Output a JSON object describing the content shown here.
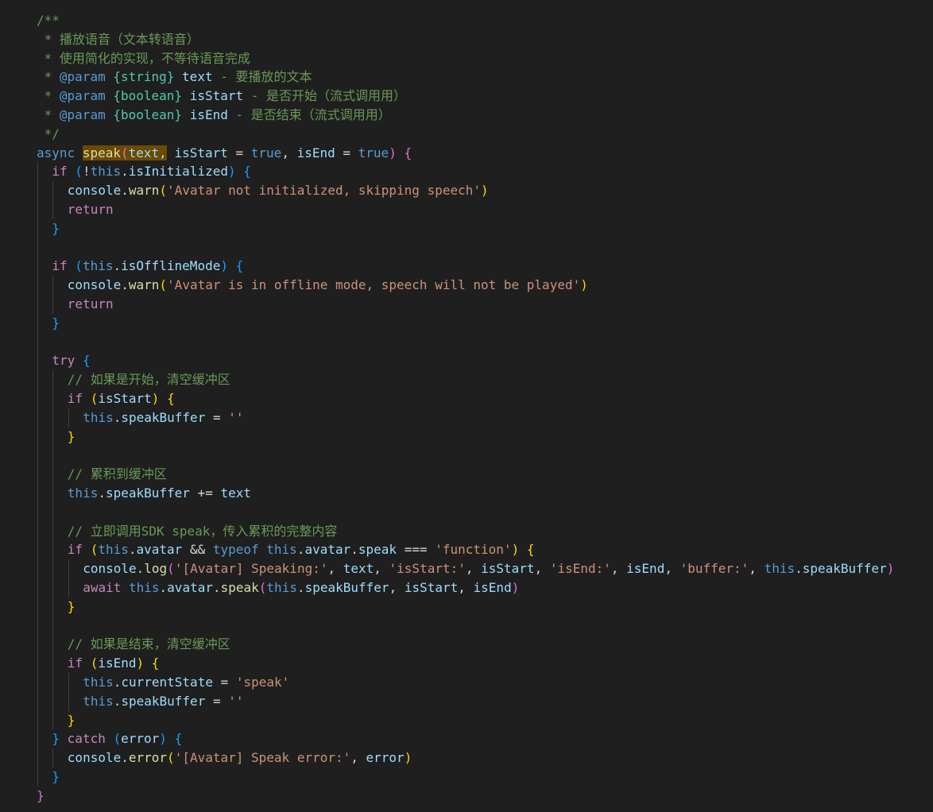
{
  "editor": {
    "language": "javascript",
    "colors": {
      "background": "#1f1f1f",
      "comment": "#6a9955",
      "keyword_control": "#c586c0",
      "keyword": "#569cd6",
      "function": "#dcdcaa",
      "variable": "#9cdcfe",
      "string": "#ce9178",
      "type": "#4ec9b0",
      "brace1": "#ffd700",
      "brace2": "#da70d6",
      "brace3": "#179fff",
      "search_highlight": "#6b4a00"
    },
    "lines": [
      {
        "indent": 0,
        "tokens": [
          [
            "/**",
            "c"
          ]
        ]
      },
      {
        "indent": 0,
        "tokens": [
          [
            " * 播放语音（文本转语音）",
            "c"
          ]
        ]
      },
      {
        "indent": 0,
        "tokens": [
          [
            " * 使用简化的实现，不等待语音完成",
            "c"
          ]
        ]
      },
      {
        "indent": 0,
        "tokens": [
          [
            " * ",
            "c"
          ],
          [
            "@param",
            "kw"
          ],
          [
            " ",
            "c"
          ],
          [
            "{string}",
            "ty"
          ],
          [
            " ",
            "c"
          ],
          [
            "text",
            "v"
          ],
          [
            " - 要播放的文本",
            "c"
          ]
        ]
      },
      {
        "indent": 0,
        "tokens": [
          [
            " * ",
            "c"
          ],
          [
            "@param",
            "kw"
          ],
          [
            " ",
            "c"
          ],
          [
            "{boolean}",
            "ty"
          ],
          [
            " ",
            "c"
          ],
          [
            "isStart",
            "v"
          ],
          [
            " - 是否开始（流式调用用）",
            "c"
          ]
        ]
      },
      {
        "indent": 0,
        "tokens": [
          [
            " * ",
            "c"
          ],
          [
            "@param",
            "kw"
          ],
          [
            " ",
            "c"
          ],
          [
            "{boolean}",
            "ty"
          ],
          [
            " ",
            "c"
          ],
          [
            "isEnd",
            "v"
          ],
          [
            " - 是否结束（流式调用用）",
            "c"
          ]
        ]
      },
      {
        "indent": 0,
        "tokens": [
          [
            " */",
            "c"
          ]
        ]
      },
      {
        "indent": 0,
        "tokens": [
          [
            "async",
            "kw"
          ],
          [
            " ",
            "p"
          ],
          [
            "speak",
            "fnh"
          ],
          [
            "(",
            "b2h"
          ],
          [
            "text,",
            "vh"
          ],
          [
            " ",
            "p"
          ],
          [
            "isStart",
            "v"
          ],
          [
            " = ",
            "p"
          ],
          [
            "true",
            "kw"
          ],
          [
            ", ",
            "p"
          ],
          [
            "isEnd",
            "v"
          ],
          [
            " = ",
            "p"
          ],
          [
            "true",
            "kw"
          ],
          [
            ")",
            "b2"
          ],
          [
            " ",
            "p"
          ],
          [
            "{",
            "b2"
          ]
        ]
      },
      {
        "indent": 1,
        "tokens": [
          [
            "if",
            "ctl"
          ],
          [
            " ",
            "p"
          ],
          [
            "(",
            "b3"
          ],
          [
            "!",
            "p"
          ],
          [
            "this",
            "kw"
          ],
          [
            ".",
            "p"
          ],
          [
            "isInitialized",
            "v"
          ],
          [
            ")",
            "b3"
          ],
          [
            " ",
            "p"
          ],
          [
            "{",
            "b3"
          ]
        ]
      },
      {
        "indent": 2,
        "tokens": [
          [
            "console",
            "v"
          ],
          [
            ".",
            "p"
          ],
          [
            "warn",
            "fn"
          ],
          [
            "(",
            "b1"
          ],
          [
            "'Avatar not initialized, skipping speech'",
            "s"
          ],
          [
            ")",
            "b1"
          ]
        ]
      },
      {
        "indent": 2,
        "tokens": [
          [
            "return",
            "ctl"
          ]
        ]
      },
      {
        "indent": 1,
        "tokens": [
          [
            "}",
            "b3"
          ]
        ]
      },
      {
        "indent": 0,
        "tokens": []
      },
      {
        "indent": 1,
        "tokens": [
          [
            "if",
            "ctl"
          ],
          [
            " ",
            "p"
          ],
          [
            "(",
            "b3"
          ],
          [
            "this",
            "kw"
          ],
          [
            ".",
            "p"
          ],
          [
            "isOfflineMode",
            "v"
          ],
          [
            ")",
            "b3"
          ],
          [
            " ",
            "p"
          ],
          [
            "{",
            "b3"
          ]
        ]
      },
      {
        "indent": 2,
        "tokens": [
          [
            "console",
            "v"
          ],
          [
            ".",
            "p"
          ],
          [
            "warn",
            "fn"
          ],
          [
            "(",
            "b1"
          ],
          [
            "'Avatar is in offline mode, speech will not be played'",
            "s"
          ],
          [
            ")",
            "b1"
          ]
        ]
      },
      {
        "indent": 2,
        "tokens": [
          [
            "return",
            "ctl"
          ]
        ]
      },
      {
        "indent": 1,
        "tokens": [
          [
            "}",
            "b3"
          ]
        ]
      },
      {
        "indent": 0,
        "tokens": []
      },
      {
        "indent": 1,
        "tokens": [
          [
            "try",
            "ctl"
          ],
          [
            " ",
            "p"
          ],
          [
            "{",
            "b3"
          ]
        ]
      },
      {
        "indent": 2,
        "tokens": [
          [
            "// 如果是开始，清空缓冲区",
            "c"
          ]
        ]
      },
      {
        "indent": 2,
        "tokens": [
          [
            "if",
            "ctl"
          ],
          [
            " ",
            "p"
          ],
          [
            "(",
            "b1"
          ],
          [
            "isStart",
            "v"
          ],
          [
            ")",
            "b1"
          ],
          [
            " ",
            "p"
          ],
          [
            "{",
            "b1"
          ]
        ]
      },
      {
        "indent": 3,
        "tokens": [
          [
            "this",
            "kw"
          ],
          [
            ".",
            "p"
          ],
          [
            "speakBuffer",
            "v"
          ],
          [
            " = ",
            "p"
          ],
          [
            "''",
            "s"
          ]
        ]
      },
      {
        "indent": 2,
        "tokens": [
          [
            "}",
            "b1"
          ]
        ]
      },
      {
        "indent": 0,
        "tokens": []
      },
      {
        "indent": 2,
        "tokens": [
          [
            "// 累积到缓冲区",
            "c"
          ]
        ]
      },
      {
        "indent": 2,
        "tokens": [
          [
            "this",
            "kw"
          ],
          [
            ".",
            "p"
          ],
          [
            "speakBuffer",
            "v"
          ],
          [
            " += ",
            "p"
          ],
          [
            "text",
            "v"
          ]
        ]
      },
      {
        "indent": 0,
        "tokens": []
      },
      {
        "indent": 2,
        "tokens": [
          [
            "// 立即调用SDK speak，传入累积的完整内容",
            "c"
          ]
        ]
      },
      {
        "indent": 2,
        "tokens": [
          [
            "if",
            "ctl"
          ],
          [
            " ",
            "p"
          ],
          [
            "(",
            "b1"
          ],
          [
            "this",
            "kw"
          ],
          [
            ".",
            "p"
          ],
          [
            "avatar",
            "v"
          ],
          [
            " && ",
            "p"
          ],
          [
            "typeof",
            "kw"
          ],
          [
            " ",
            "p"
          ],
          [
            "this",
            "kw"
          ],
          [
            ".",
            "p"
          ],
          [
            "avatar",
            "v"
          ],
          [
            ".",
            "p"
          ],
          [
            "speak",
            "v"
          ],
          [
            " === ",
            "p"
          ],
          [
            "'function'",
            "s"
          ],
          [
            ")",
            "b1"
          ],
          [
            " ",
            "p"
          ],
          [
            "{",
            "b1"
          ]
        ]
      },
      {
        "indent": 3,
        "tokens": [
          [
            "console",
            "v"
          ],
          [
            ".",
            "p"
          ],
          [
            "log",
            "fn"
          ],
          [
            "(",
            "b2"
          ],
          [
            "'[Avatar] Speaking:'",
            "s"
          ],
          [
            ", ",
            "p"
          ],
          [
            "text",
            "v"
          ],
          [
            ", ",
            "p"
          ],
          [
            "'isStart:'",
            "s"
          ],
          [
            ", ",
            "p"
          ],
          [
            "isStart",
            "v"
          ],
          [
            ", ",
            "p"
          ],
          [
            "'isEnd:'",
            "s"
          ],
          [
            ", ",
            "p"
          ],
          [
            "isEnd",
            "v"
          ],
          [
            ", ",
            "p"
          ],
          [
            "'buffer:'",
            "s"
          ],
          [
            ", ",
            "p"
          ],
          [
            "this",
            "kw"
          ],
          [
            ".",
            "p"
          ],
          [
            "speakBuffer",
            "v"
          ],
          [
            ")",
            "b2"
          ]
        ]
      },
      {
        "indent": 3,
        "tokens": [
          [
            "await",
            "ctl"
          ],
          [
            " ",
            "p"
          ],
          [
            "this",
            "kw"
          ],
          [
            ".",
            "p"
          ],
          [
            "avatar",
            "v"
          ],
          [
            ".",
            "p"
          ],
          [
            "speak",
            "fn"
          ],
          [
            "(",
            "b2"
          ],
          [
            "this",
            "kw"
          ],
          [
            ".",
            "p"
          ],
          [
            "speakBuffer",
            "v"
          ],
          [
            ", ",
            "p"
          ],
          [
            "isStart",
            "v"
          ],
          [
            ", ",
            "p"
          ],
          [
            "isEnd",
            "v"
          ],
          [
            ")",
            "b2"
          ]
        ]
      },
      {
        "indent": 2,
        "tokens": [
          [
            "}",
            "b1"
          ]
        ]
      },
      {
        "indent": 0,
        "tokens": []
      },
      {
        "indent": 2,
        "tokens": [
          [
            "// 如果是结束，清空缓冲区",
            "c"
          ]
        ]
      },
      {
        "indent": 2,
        "tokens": [
          [
            "if",
            "ctl"
          ],
          [
            " ",
            "p"
          ],
          [
            "(",
            "b1"
          ],
          [
            "isEnd",
            "v"
          ],
          [
            ")",
            "b1"
          ],
          [
            " ",
            "p"
          ],
          [
            "{",
            "b1"
          ]
        ]
      },
      {
        "indent": 3,
        "tokens": [
          [
            "this",
            "kw"
          ],
          [
            ".",
            "p"
          ],
          [
            "currentState",
            "v"
          ],
          [
            " = ",
            "p"
          ],
          [
            "'speak'",
            "s"
          ]
        ]
      },
      {
        "indent": 3,
        "tokens": [
          [
            "this",
            "kw"
          ],
          [
            ".",
            "p"
          ],
          [
            "speakBuffer",
            "v"
          ],
          [
            " = ",
            "p"
          ],
          [
            "''",
            "s"
          ]
        ]
      },
      {
        "indent": 2,
        "tokens": [
          [
            "}",
            "b1"
          ]
        ]
      },
      {
        "indent": 1,
        "tokens": [
          [
            "}",
            "b3"
          ],
          [
            " ",
            "p"
          ],
          [
            "catch",
            "ctl"
          ],
          [
            " ",
            "p"
          ],
          [
            "(",
            "b3"
          ],
          [
            "error",
            "v"
          ],
          [
            ")",
            "b3"
          ],
          [
            " ",
            "p"
          ],
          [
            "{",
            "b3"
          ]
        ]
      },
      {
        "indent": 2,
        "tokens": [
          [
            "console",
            "v"
          ],
          [
            ".",
            "p"
          ],
          [
            "error",
            "fn"
          ],
          [
            "(",
            "b1"
          ],
          [
            "'[Avatar] Speak error:'",
            "s"
          ],
          [
            ", ",
            "p"
          ],
          [
            "error",
            "v"
          ],
          [
            ")",
            "b1"
          ]
        ]
      },
      {
        "indent": 1,
        "tokens": [
          [
            "}",
            "b3"
          ]
        ]
      },
      {
        "indent": 0,
        "tokens": [
          [
            "}",
            "b2"
          ]
        ]
      }
    ]
  }
}
